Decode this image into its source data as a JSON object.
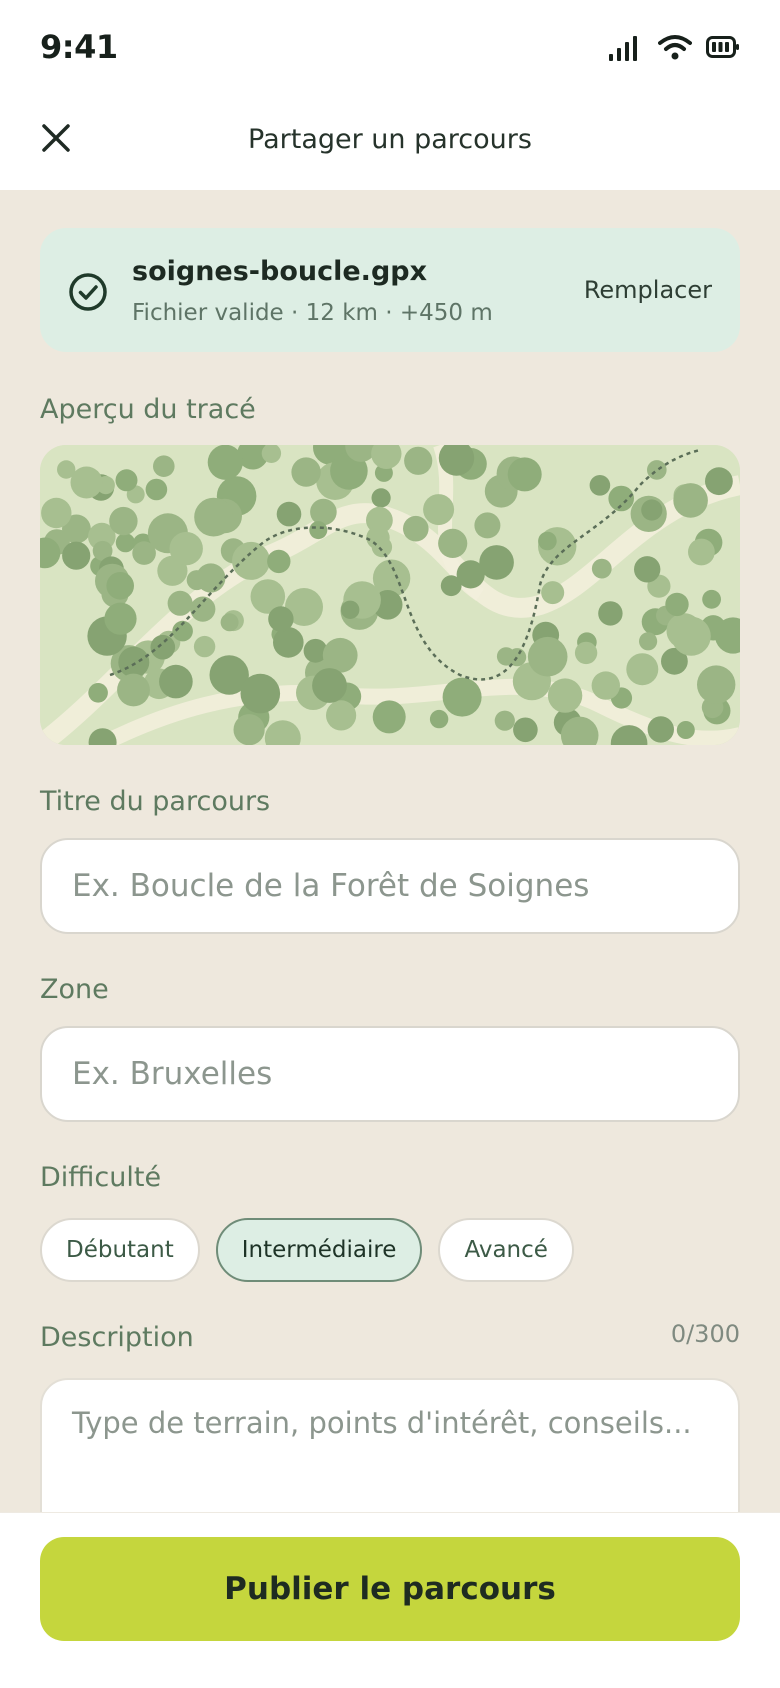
{
  "status_bar": {
    "time": "9:41"
  },
  "nav": {
    "title": "Partager un parcours"
  },
  "file": {
    "name": "soignes-boucle.gpx",
    "meta": "Fichier valide · 12 km · +450 m",
    "replace_label": "Remplacer"
  },
  "preview": {
    "label": "Aperçu du tracé"
  },
  "title_field": {
    "label": "Titre du parcours",
    "placeholder": "Ex. Boucle de la Forêt de Soignes",
    "value": ""
  },
  "zone_field": {
    "label": "Zone",
    "placeholder": "Ex. Bruxelles",
    "value": ""
  },
  "difficulty": {
    "label": "Difficulté",
    "options": [
      "Débutant",
      "Intermédiaire",
      "Avancé"
    ],
    "selected": "Intermédiaire"
  },
  "description": {
    "label": "Description",
    "counter": "0/300",
    "placeholder": "Type de terrain, points d'intérêt, conseils..."
  },
  "publish_label": "Publier le parcours",
  "colors": {
    "background": "#EEE8DD",
    "accent": "#C5D63D",
    "success_card": "#DDEEE4",
    "label": "#5E7A60"
  }
}
